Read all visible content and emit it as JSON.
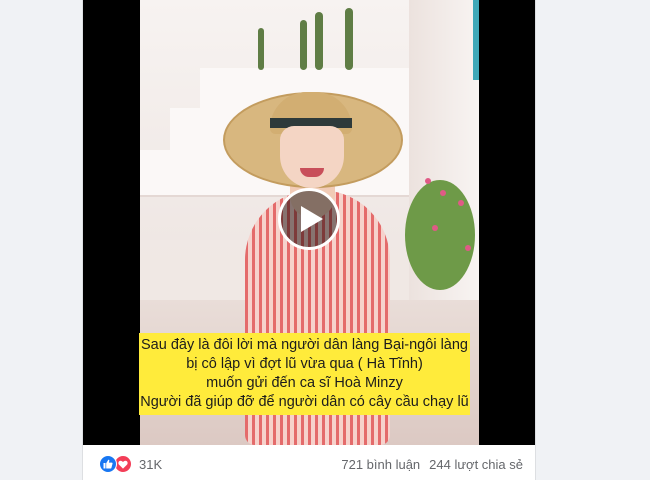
{
  "post": {
    "video": {
      "caption_lines": [
        "Sau đây là đôi lời mà người dân làng Bại-ngôi làng",
        "bị cô lập vì đợt lũ vừa qua ( Hà Tĩnh)",
        "muốn gửi đến ca sĩ Hoà Minzy",
        "Người đã giúp đỡ để người dân có cây cầu chạy lũ"
      ],
      "caption_bg_color": "#ffeb3b",
      "play_icon": "play-icon"
    },
    "footer": {
      "reaction_icons": [
        "like-icon",
        "love-icon"
      ],
      "reaction_count": "31K",
      "comments": "721 bình luận",
      "shares": "244 lượt chia sẻ"
    }
  },
  "colors": {
    "like": "#1877f2",
    "love": "#f33e58",
    "page_bg": "#f0f2f5"
  }
}
